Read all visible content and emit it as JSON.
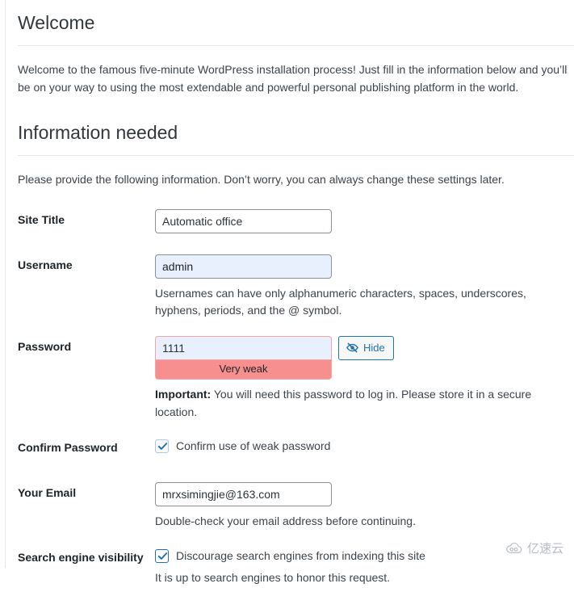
{
  "welcome": {
    "heading": "Welcome",
    "intro": "Welcome to the famous five-minute WordPress installation process! Just fill in the information below and you’ll be on your way to using the most extendable and powerful personal publishing platform in the world."
  },
  "info": {
    "heading": "Information needed",
    "intro": "Please provide the following information. Don’t worry, you can always change these settings later."
  },
  "form": {
    "site_title": {
      "label": "Site Title",
      "value": "Automatic office"
    },
    "username": {
      "label": "Username",
      "value": "admin",
      "description": "Usernames can have only alphanumeric characters, spaces, underscores, hyphens, periods, and the @ symbol."
    },
    "password": {
      "label": "Password",
      "value": "1111",
      "strength": "Very weak",
      "toggle_label": "Hide",
      "toggle_icon": "eye-slash-icon",
      "important_label": "Important:",
      "description": " You will need this password to log in. Please store it in a secure location."
    },
    "confirm_password": {
      "label": "Confirm Password",
      "checkbox_label": "Confirm use of weak password",
      "checked": "true"
    },
    "email": {
      "label": "Your Email",
      "value": "mrxsimingjie@163.com",
      "description": "Double-check your email address before continuing."
    },
    "search_visibility": {
      "label": "Search engine visibility",
      "checkbox_label": "Discourage search engines from indexing this site",
      "checked": "true",
      "description": "It is up to search engines to honor this request."
    }
  },
  "watermark": {
    "text": "亿速云",
    "icon": "cloud-icon"
  },
  "colors": {
    "accent": "#2271b1",
    "heading": "#32373c",
    "text": "#3c434a",
    "autofill_bg": "#e8f0fe",
    "weak_bar": "#f78f8f",
    "weak_border": "#f0a3a8",
    "input_border": "#8c8f94",
    "rule": "#e5e5e5"
  }
}
